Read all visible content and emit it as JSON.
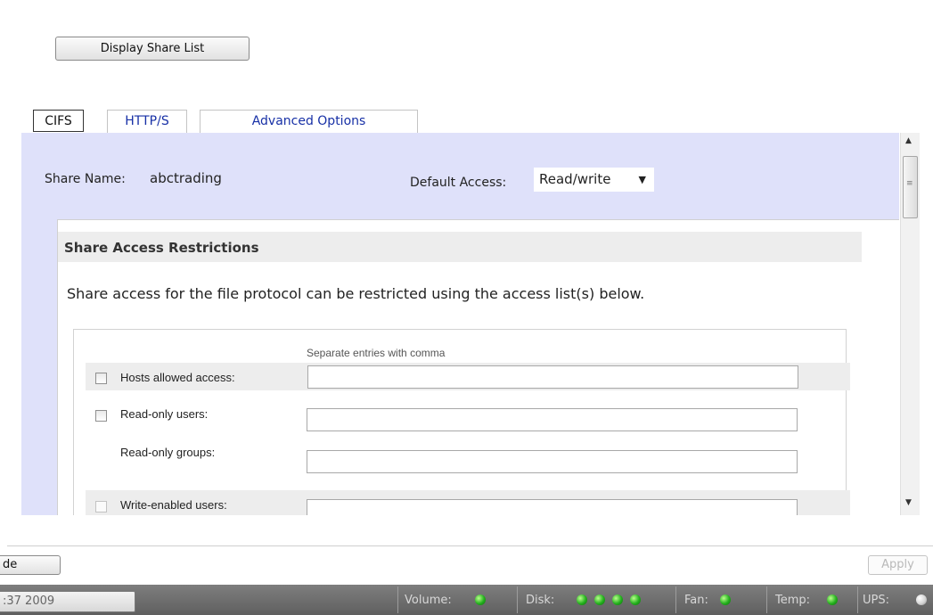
{
  "top": {
    "display_share_list": "Display Share List"
  },
  "tabs": [
    {
      "label": "CIFS",
      "active": true
    },
    {
      "label": "HTTP/S",
      "active": false
    },
    {
      "label": "Advanced Options",
      "active": false
    }
  ],
  "share": {
    "name_label": "Share Name:",
    "name_value": "abctrading",
    "default_access_label": "Default Access:",
    "default_access_value": "Read/write"
  },
  "restrictions": {
    "title": "Share Access Restrictions",
    "description": "Share access for the file protocol can be restricted using the access list(s) below.",
    "hint": "Separate entries with comma",
    "rows": [
      {
        "label": "Hosts allowed access:",
        "checked": false,
        "value": ""
      },
      {
        "label": "Read-only users:",
        "checked": false,
        "value": ""
      },
      {
        "label": "Read-only groups:",
        "value": ""
      },
      {
        "label": "Write-enabled users:",
        "checked": false,
        "value": ""
      }
    ]
  },
  "footer": {
    "left_button": "de",
    "apply_button": "Apply"
  },
  "status": {
    "datetime": ":37 2009",
    "volume_label": "Volume:",
    "disk_label": "Disk:",
    "fan_label": "Fan:",
    "temp_label": "Temp:",
    "ups_label": "UPS:",
    "led_on_color": "#23b01d",
    "led_off_color": "#d5d5d5"
  }
}
